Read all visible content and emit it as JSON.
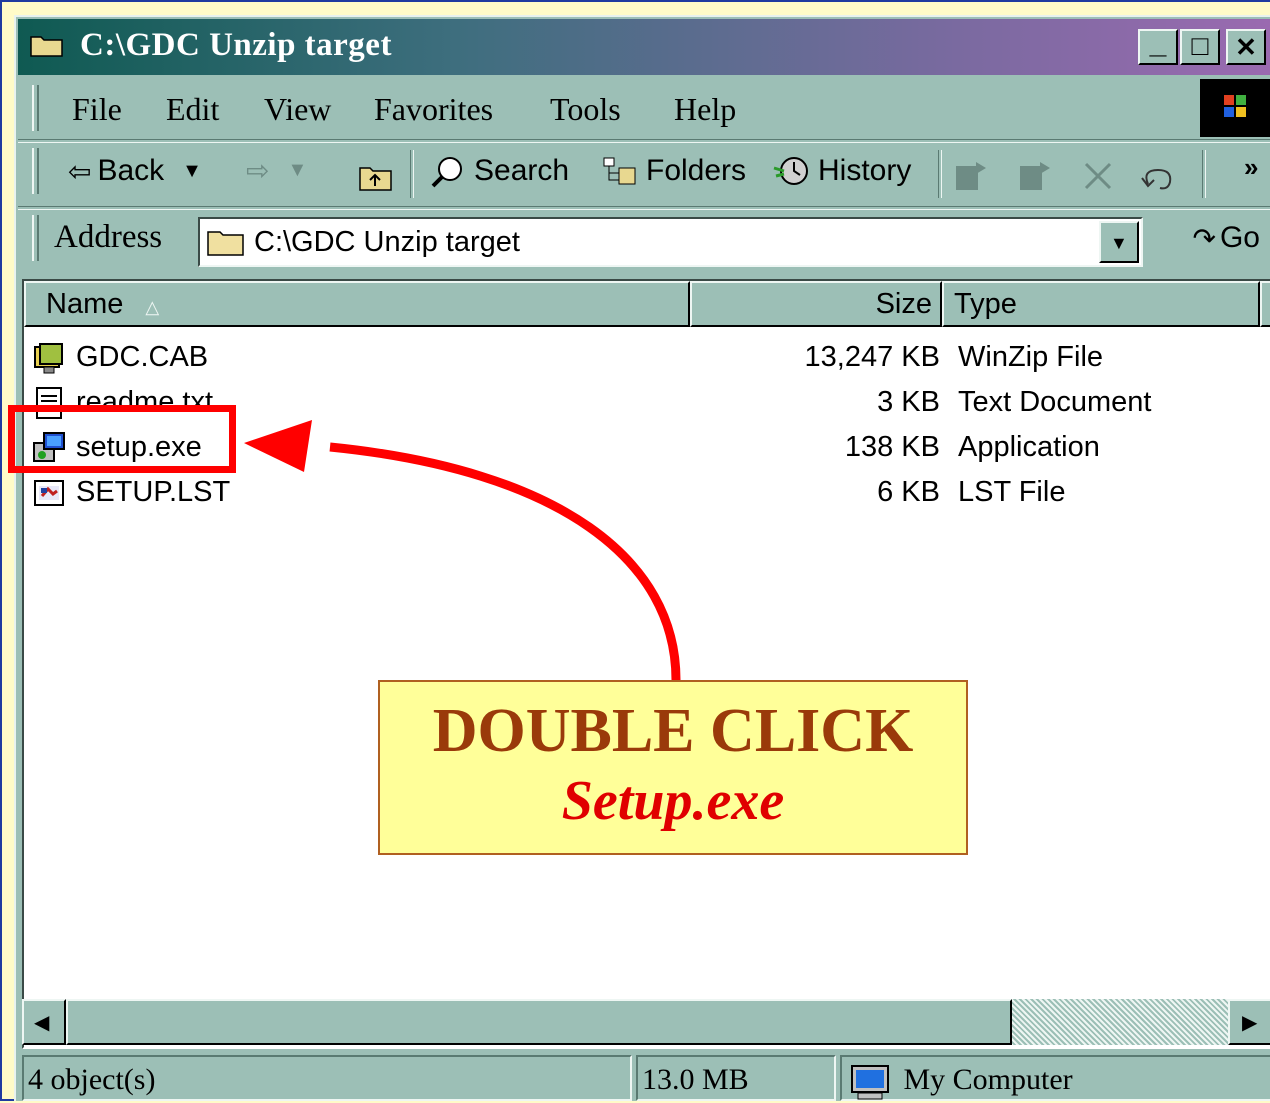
{
  "window": {
    "title": "C:\\GDC Unzip target",
    "minimize_glyph": "_",
    "maximize_glyph": "□",
    "close_glyph": "✕"
  },
  "menu": {
    "items": [
      "File",
      "Edit",
      "View",
      "Favorites",
      "Tools",
      "Help"
    ]
  },
  "toolbar": {
    "back_label": "Back",
    "search_label": "Search",
    "folders_label": "Folders",
    "history_label": "History",
    "more_glyph": "»"
  },
  "address": {
    "label": "Address",
    "value": "C:\\GDC Unzip target",
    "go_label": "Go"
  },
  "columns": {
    "name": "Name",
    "size": "Size",
    "type": "Type"
  },
  "files": [
    {
      "name": "GDC.CAB",
      "size": "13,247 KB",
      "type": "WinZip File",
      "icon": "winzip-icon"
    },
    {
      "name": "readme.txt",
      "size": "3 KB",
      "type": "Text Document",
      "icon": "text-document-icon"
    },
    {
      "name": "setup.exe",
      "size": "138 KB",
      "type": "Application",
      "icon": "application-icon"
    },
    {
      "name": "SETUP.LST",
      "size": "6 KB",
      "type": "LST File",
      "icon": "lst-file-icon"
    }
  ],
  "status": {
    "objects": "4 object(s)",
    "size": "13.0 MB",
    "location": "My Computer"
  },
  "annotation": {
    "line1": "DOUBLE CLICK",
    "line2": "Setup.exe",
    "highlight_color": "#ff0000",
    "box_color": "#ffff99"
  }
}
